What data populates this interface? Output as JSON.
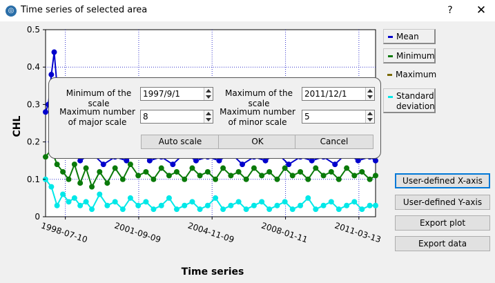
{
  "window": {
    "title": "Time series of selected area",
    "help_symbol": "?",
    "close_symbol": "✕",
    "icon": "app-logo-icon"
  },
  "legend": [
    {
      "label": "Mean",
      "color": "#0000cc"
    },
    {
      "label": "Minimum",
      "color": "#0a7a0a"
    },
    {
      "label": "Maximum",
      "color": "#7a6a00"
    },
    {
      "label": "Standard deviation",
      "color": "#00e8e8"
    }
  ],
  "buttons": {
    "x_axis": "User-defined X-axis",
    "y_axis": "User-defined Y-axis",
    "export_plot": "Export plot",
    "export_data": "Export data"
  },
  "dialog": {
    "min_scale_label": "Minimum of the scale",
    "min_scale_value": "1997/9/1",
    "max_scale_label": "Maximum of the scale",
    "max_scale_value": "2011/12/1",
    "major_label_line1": "Maximum number",
    "major_label_line2": "of major scale",
    "major_value": "8",
    "minor_label_line1": "Maximum number",
    "minor_label_line2": "of minor scale",
    "minor_value": "5",
    "auto_scale": "Auto scale",
    "ok": "OK",
    "cancel": "Cancel"
  },
  "chart_data": {
    "type": "line",
    "xlabel": "Time series",
    "ylabel": "CHL",
    "ylim": [
      0,
      0.5
    ],
    "yticks": [
      "0",
      "0.1",
      "0.2",
      "0.3",
      "0.4",
      "0.5"
    ],
    "xticks": [
      "1998-07-10",
      "2001-09-09",
      "2004-11-09",
      "2008-01-11",
      "2011-03-13"
    ],
    "xlim": [
      "1997-09-01",
      "2011-12-01"
    ],
    "grid": true,
    "legend_position": "right",
    "series": [
      {
        "name": "Mean",
        "color": "#0000cc",
        "x": [
          "1997-09-01",
          "1997-10-15",
          "1997-12-01",
          "1998-01-15",
          "1998-03-01",
          "1998-06-01",
          "1998-09-01",
          "1999-03-01",
          "1999-09-01",
          "2000-03-01",
          "2000-09-01",
          "2001-03-01",
          "2001-09-01",
          "2002-03-01",
          "2002-09-01",
          "2003-03-01",
          "2003-09-01",
          "2004-03-01",
          "2004-09-01",
          "2005-03-01",
          "2005-09-01",
          "2006-03-01",
          "2006-09-01",
          "2007-03-01",
          "2007-09-01",
          "2008-03-01",
          "2008-09-01",
          "2009-03-01",
          "2009-09-01",
          "2010-03-01",
          "2010-09-01",
          "2011-03-01",
          "2011-09-01",
          "2011-12-01"
        ],
        "y": [
          0.28,
          0.3,
          0.38,
          0.44,
          0.35,
          0.25,
          0.2,
          0.15,
          0.17,
          0.14,
          0.16,
          0.15,
          0.18,
          0.15,
          0.16,
          0.14,
          0.17,
          0.15,
          0.16,
          0.15,
          0.17,
          0.14,
          0.16,
          0.15,
          0.17,
          0.14,
          0.16,
          0.15,
          0.16,
          0.14,
          0.17,
          0.15,
          0.16,
          0.15
        ]
      },
      {
        "name": "Minimum",
        "color": "#0a7a0a",
        "x": [
          "1997-09-01",
          "1997-12-01",
          "1998-03-01",
          "1998-06-01",
          "1998-09-01",
          "1998-12-01",
          "1999-03-01",
          "1999-06-01",
          "1999-09-01",
          "2000-01-01",
          "2000-05-01",
          "2000-09-01",
          "2001-01-01",
          "2001-05-01",
          "2001-09-01",
          "2002-01-01",
          "2002-05-01",
          "2002-09-01",
          "2003-01-01",
          "2003-05-01",
          "2003-09-01",
          "2004-01-01",
          "2004-05-01",
          "2004-09-01",
          "2005-01-01",
          "2005-05-01",
          "2005-09-01",
          "2006-01-01",
          "2006-05-01",
          "2006-09-01",
          "2007-01-01",
          "2007-05-01",
          "2007-09-01",
          "2008-01-01",
          "2008-05-01",
          "2008-09-01",
          "2009-01-01",
          "2009-05-01",
          "2009-09-01",
          "2010-01-01",
          "2010-05-01",
          "2010-09-01",
          "2011-01-01",
          "2011-05-01",
          "2011-09-01",
          "2011-12-01"
        ],
        "y": [
          0.16,
          0.18,
          0.14,
          0.12,
          0.1,
          0.14,
          0.09,
          0.13,
          0.08,
          0.12,
          0.09,
          0.13,
          0.1,
          0.14,
          0.11,
          0.12,
          0.1,
          0.13,
          0.11,
          0.12,
          0.1,
          0.13,
          0.11,
          0.12,
          0.1,
          0.13,
          0.11,
          0.12,
          0.1,
          0.13,
          0.11,
          0.12,
          0.1,
          0.13,
          0.11,
          0.12,
          0.1,
          0.13,
          0.11,
          0.12,
          0.1,
          0.13,
          0.11,
          0.12,
          0.1,
          0.11
        ]
      },
      {
        "name": "Standard deviation",
        "color": "#00e8e8",
        "x": [
          "1997-09-01",
          "1997-12-01",
          "1998-03-01",
          "1998-06-01",
          "1998-09-01",
          "1998-12-01",
          "1999-03-01",
          "1999-06-01",
          "1999-09-01",
          "2000-01-01",
          "2000-05-01",
          "2000-09-01",
          "2001-01-01",
          "2001-05-01",
          "2001-09-01",
          "2002-01-01",
          "2002-05-01",
          "2002-09-01",
          "2003-01-01",
          "2003-05-01",
          "2003-09-01",
          "2004-01-01",
          "2004-05-01",
          "2004-09-01",
          "2005-01-01",
          "2005-05-01",
          "2005-09-01",
          "2006-01-01",
          "2006-05-01",
          "2006-09-01",
          "2007-01-01",
          "2007-05-01",
          "2007-09-01",
          "2008-01-01",
          "2008-05-01",
          "2008-09-01",
          "2009-01-01",
          "2009-05-01",
          "2009-09-01",
          "2010-01-01",
          "2010-05-01",
          "2010-09-01",
          "2011-01-01",
          "2011-05-01",
          "2011-09-01",
          "2011-12-01"
        ],
        "y": [
          0.1,
          0.08,
          0.03,
          0.06,
          0.04,
          0.05,
          0.03,
          0.04,
          0.02,
          0.06,
          0.03,
          0.04,
          0.02,
          0.05,
          0.03,
          0.04,
          0.02,
          0.03,
          0.05,
          0.02,
          0.03,
          0.04,
          0.02,
          0.03,
          0.05,
          0.02,
          0.03,
          0.04,
          0.02,
          0.03,
          0.04,
          0.02,
          0.03,
          0.04,
          0.02,
          0.03,
          0.05,
          0.02,
          0.03,
          0.04,
          0.02,
          0.03,
          0.04,
          0.02,
          0.03,
          0.03
        ]
      }
    ]
  }
}
